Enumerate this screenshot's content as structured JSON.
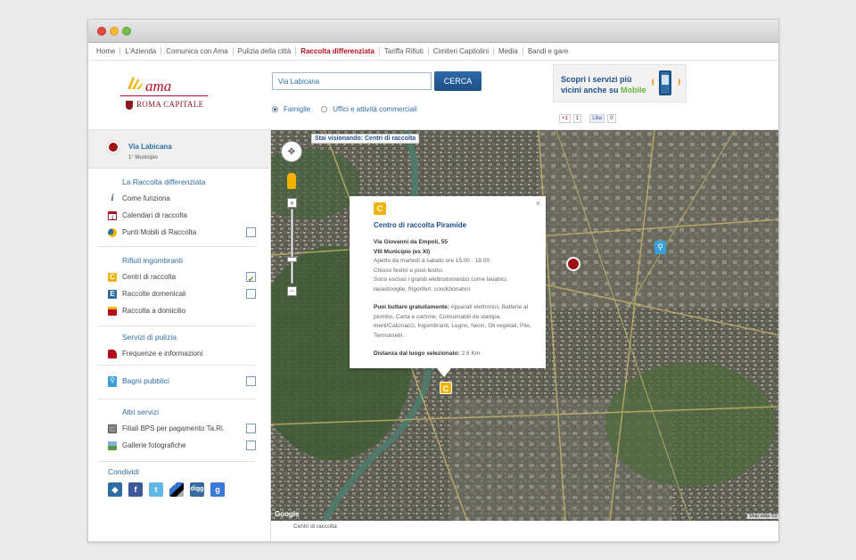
{
  "nav": [
    "Home",
    "L'Azienda",
    "Comunica con Ama",
    "Pulizia della città",
    "Raccolta differenziata",
    "Tariffa Rifiuti",
    "Cimiteri Capitolini",
    "Media",
    "Bandi e gare"
  ],
  "nav_active": "Raccolta differenziata",
  "logo": {
    "ama": "ama",
    "roma": "ROMA CAPITALE"
  },
  "search": {
    "value": "Via Labicana",
    "button": "CERCA"
  },
  "radios": {
    "opt1": "Famiglie",
    "opt2": "Uffici e attività commerciali"
  },
  "mobile": {
    "line1": "Scopri i servizi più",
    "line2": "vicini anche su",
    "line2b": "Mobile"
  },
  "social": {
    "gplus": "+1",
    "gcount": "1",
    "fblike": "Like",
    "fcount": "0"
  },
  "location": {
    "name": "Via Labicana",
    "municipio": "1° Municipio"
  },
  "sidebar": {
    "sec1": "La Raccolta differenziata",
    "come": "Come funziona",
    "calendari": "Calendari di raccolta",
    "punti": "Punti Mobili di Raccolta",
    "sec2": "Rifiuti ingombranti",
    "centri": "Centri di raccolta",
    "domenicali": "Raccolte domenicali",
    "domicilio": "Raccolta a domicilio",
    "sec3": "Servizi di pulizia",
    "frequenze": "Frequenze e informazioni",
    "bagni": "Bagni pubblici",
    "sec4": "Altri servizi",
    "filiali": "Filiali BPS per pagamento Ta.Ri.",
    "gallerie": "Gallerie fotografiche",
    "condividi": "Condividi"
  },
  "map": {
    "banner": "Stai visionando: Centri di raccolta",
    "footer": "Centri di raccolta",
    "google": "Google",
    "mapdata": "Map data ©2"
  },
  "popup": {
    "icon": "C",
    "title": "Centro di raccolta Piramide",
    "addr": "Via Giovanni da Empoli, 55",
    "mun": "VIII Municipio (ex XI)",
    "hours": "Aperto da martedì a sabato ore 15.00 - 18.00",
    "closed": "Chiuso festivi e post-festivi.",
    "excl": "Sono esclusi i grandi elettrodomestici come lavatrici, lavastoviglie, frigoriferi, condizionatori.",
    "puoi_label": "Puoi buttare gratuitamente:",
    "puoi": " Apparati elettronici, Batterie al piombo, Carta e cartone, Consumabili da stampa, Inerti/Calcinacci, Ingombranti, Legno, Neon, Oli vegetali, Pile, Termometri.",
    "dist_label": "Distanza dal luogo selezionato:",
    "dist": " 2.6 Km"
  }
}
